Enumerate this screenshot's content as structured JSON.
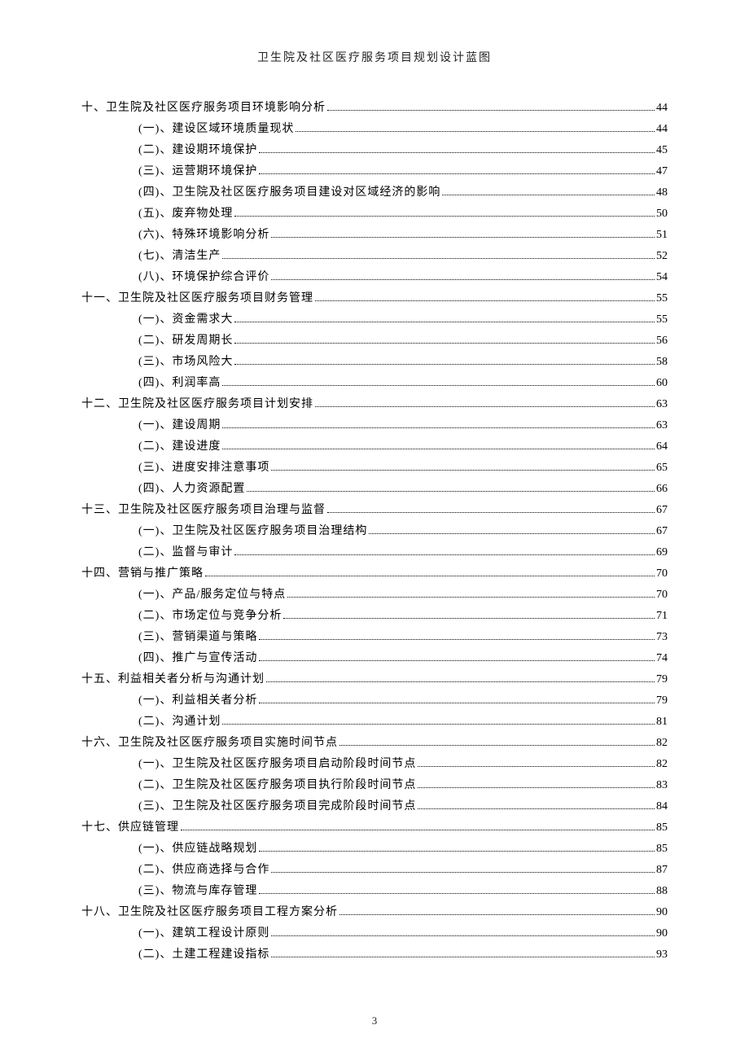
{
  "header": "卫生院及社区医疗服务项目规划设计蓝图",
  "page_number": "3",
  "toc": [
    {
      "level": 1,
      "label": "十、卫生院及社区医疗服务项目环境影响分析",
      "page": "44"
    },
    {
      "level": 2,
      "label": "(一)、建设区域环境质量现状",
      "page": "44"
    },
    {
      "level": 2,
      "label": "(二)、建设期环境保护",
      "page": "45"
    },
    {
      "level": 2,
      "label": "(三)、运营期环境保护",
      "page": "47"
    },
    {
      "level": 2,
      "label": "(四)、卫生院及社区医疗服务项目建设对区域经济的影响",
      "page": "48"
    },
    {
      "level": 2,
      "label": "(五)、废弃物处理",
      "page": "50"
    },
    {
      "level": 2,
      "label": "(六)、特殊环境影响分析",
      "page": "51"
    },
    {
      "level": 2,
      "label": "(七)、清洁生产",
      "page": "52"
    },
    {
      "level": 2,
      "label": "(八)、环境保护综合评价",
      "page": "54"
    },
    {
      "level": 1,
      "label": "十一、卫生院及社区医疗服务项目财务管理",
      "page": "55"
    },
    {
      "level": 2,
      "label": "(一)、资金需求大",
      "page": "55"
    },
    {
      "level": 2,
      "label": "(二)、研发周期长",
      "page": "56"
    },
    {
      "level": 2,
      "label": "(三)、市场风险大",
      "page": "58"
    },
    {
      "level": 2,
      "label": "(四)、利润率高",
      "page": "60"
    },
    {
      "level": 1,
      "label": "十二、卫生院及社区医疗服务项目计划安排",
      "page": "63"
    },
    {
      "level": 2,
      "label": "(一)、建设周期",
      "page": "63"
    },
    {
      "level": 2,
      "label": "(二)、建设进度",
      "page": "64"
    },
    {
      "level": 2,
      "label": "(三)、进度安排注意事项",
      "page": "65"
    },
    {
      "level": 2,
      "label": "(四)、人力资源配置",
      "page": "66"
    },
    {
      "level": 1,
      "label": "十三、卫生院及社区医疗服务项目治理与监督",
      "page": "67"
    },
    {
      "level": 2,
      "label": "(一)、卫生院及社区医疗服务项目治理结构",
      "page": "67"
    },
    {
      "level": 2,
      "label": "(二)、监督与审计",
      "page": "69"
    },
    {
      "level": 1,
      "label": "十四、营销与推广策略",
      "page": "70"
    },
    {
      "level": 2,
      "label": "(一)、产品/服务定位与特点",
      "page": "70"
    },
    {
      "level": 2,
      "label": "(二)、市场定位与竞争分析",
      "page": "71"
    },
    {
      "level": 2,
      "label": "(三)、营销渠道与策略",
      "page": "73"
    },
    {
      "level": 2,
      "label": "(四)、推广与宣传活动",
      "page": "74"
    },
    {
      "level": 1,
      "label": "十五、利益相关者分析与沟通计划",
      "page": "79"
    },
    {
      "level": 2,
      "label": "(一)、利益相关者分析",
      "page": "79"
    },
    {
      "level": 2,
      "label": "(二)、沟通计划",
      "page": "81"
    },
    {
      "level": 1,
      "label": "十六、卫生院及社区医疗服务项目实施时间节点",
      "page": "82"
    },
    {
      "level": 2,
      "label": "(一)、卫生院及社区医疗服务项目启动阶段时间节点",
      "page": "82"
    },
    {
      "level": 2,
      "label": "(二)、卫生院及社区医疗服务项目执行阶段时间节点",
      "page": "83"
    },
    {
      "level": 2,
      "label": "(三)、卫生院及社区医疗服务项目完成阶段时间节点",
      "page": "84"
    },
    {
      "level": 1,
      "label": "十七、供应链管理",
      "page": "85"
    },
    {
      "level": 2,
      "label": "(一)、供应链战略规划",
      "page": "85"
    },
    {
      "level": 2,
      "label": "(二)、供应商选择与合作",
      "page": "87"
    },
    {
      "level": 2,
      "label": "(三)、物流与库存管理",
      "page": "88"
    },
    {
      "level": 1,
      "label": "十八、卫生院及社区医疗服务项目工程方案分析",
      "page": "90"
    },
    {
      "level": 2,
      "label": "(一)、建筑工程设计原则",
      "page": "90"
    },
    {
      "level": 2,
      "label": "(二)、土建工程建设指标",
      "page": "93"
    }
  ]
}
